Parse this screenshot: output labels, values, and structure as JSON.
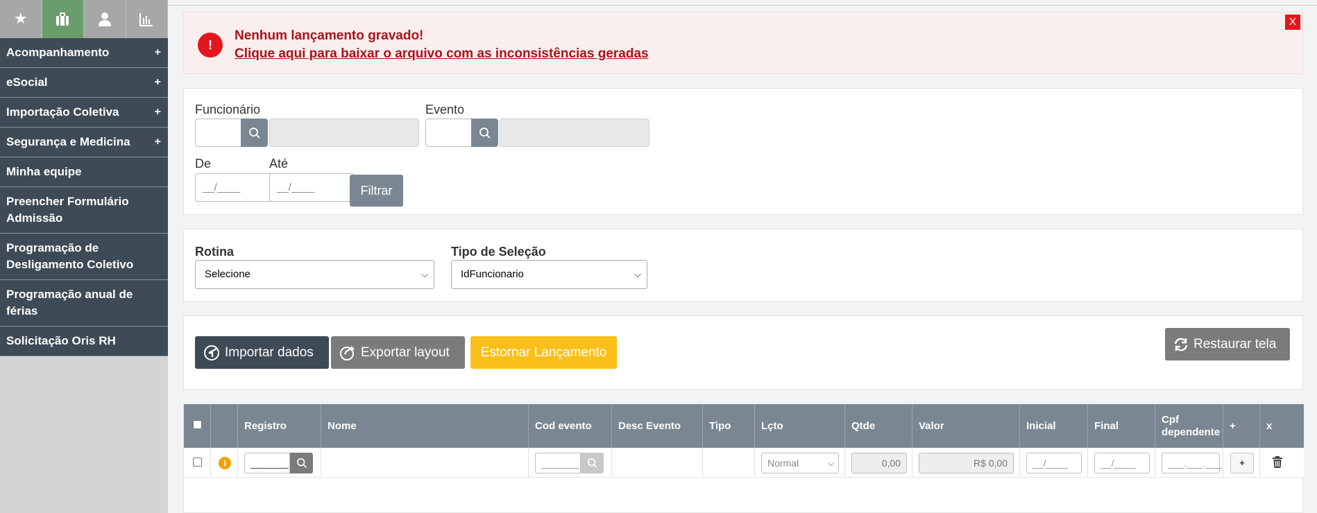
{
  "sidebar": {
    "tabs": [
      {
        "icon": "star-icon",
        "glyph": "★"
      },
      {
        "icon": "briefcase-icon",
        "glyph": ""
      },
      {
        "icon": "user-icon",
        "glyph": ""
      },
      {
        "icon": "bar-chart-icon",
        "glyph": ""
      }
    ],
    "items": [
      {
        "label": "Acompanhamento",
        "plus": "+"
      },
      {
        "label": "eSocial",
        "plus": "+"
      },
      {
        "label": "Importação Coletiva",
        "plus": "+"
      },
      {
        "label": "Segurança e Medicina",
        "plus": "+"
      },
      {
        "label": "Minha equipe"
      },
      {
        "label": "Preencher Formulário Admissão"
      },
      {
        "label": "Programação de Desligamento Coletivo"
      },
      {
        "label": "Programação anual de férias"
      },
      {
        "label": "Solicitação Oris RH"
      }
    ]
  },
  "alert": {
    "icon": "!",
    "title": "Nenhum lançamento gravado!",
    "link": "Clique aqui para baixar o arquivo com as inconsistências geradas",
    "close": "X"
  },
  "filter": {
    "funcionario_label": "Funcionário",
    "evento_label": "Evento",
    "de_label": "De",
    "ate_label": "Até",
    "date_placeholder": "__/____",
    "filtrar_button": "Filtrar"
  },
  "rotina": {
    "rotina_label": "Rotina",
    "rotina_value": "Selecione",
    "tipo_label": "Tipo de Seleção",
    "tipo_value": "IdFuncionario"
  },
  "actions": {
    "importar": "Importar dados",
    "exportar": "Exportar layout",
    "estornar": "Estornar Lançamento",
    "restaurar": "Restaurar tela"
  },
  "grid": {
    "headers": {
      "registro": "Registro",
      "nome": "Nome",
      "cod_evento": "Cod evento",
      "desc_evento": "Desc Evento",
      "tipo": "Tipo",
      "lcto": "Lçto",
      "qtde": "Qtde",
      "valor": "Valor",
      "inicial": "Inicial",
      "final": "Final",
      "cpf_dependente": "Cpf dependente",
      "add": "+",
      "remove": "x"
    },
    "row": {
      "registro_placeholder": "_______",
      "cod_placeholder": "_______",
      "lcto_value": "Normal",
      "qtde_value": "0,00",
      "valor_value": "R$ 0,00",
      "inicial_placeholder": "__/____",
      "final_placeholder": "__/____",
      "cpf_placeholder": "___.___.___",
      "add_button": "+"
    }
  }
}
